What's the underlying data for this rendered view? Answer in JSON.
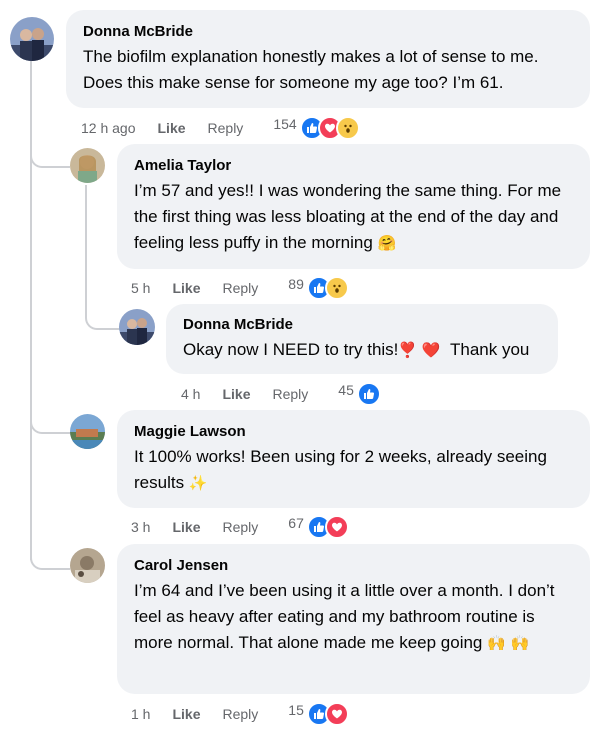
{
  "comments": [
    {
      "author": "Donna McBride",
      "text": "The biofilm explanation honestly makes a lot of sense to me. Does this make sense for someone my age too? I’m 61.",
      "time": "12 h ago",
      "like": "Like",
      "reply": "Reply",
      "count": "154",
      "reactions": [
        "like-icon",
        "love-icon",
        "wow-icon"
      ]
    },
    {
      "author": "Amelia Taylor",
      "text": "I’m 57 and yes!! I was wondering the same thing. For me the first thing was less bloating at the end of the day and feeling less puffy in the morning",
      "emoji": "🤗",
      "time": "5 h",
      "like": "Like",
      "reply": "Reply",
      "count": "89",
      "reactions": [
        "like-icon",
        "wow-icon"
      ]
    },
    {
      "author": "Donna McBride",
      "text": "Okay now I NEED to try this!",
      "emoji": "❣️ ❤️",
      "text_end": "Thank you",
      "time": "4 h",
      "like": "Like",
      "reply": "Reply",
      "count": "45",
      "reactions": [
        "like-icon"
      ]
    },
    {
      "author": "Maggie Lawson",
      "text": "It 100% works! Been using for 2 weeks, already seeing results",
      "emoji": "✨",
      "time": "3 h",
      "like": "Like",
      "reply": "Reply",
      "count": "67",
      "reactions": [
        "like-icon",
        "love-icon"
      ]
    },
    {
      "author": "Carol Jensen",
      "text": "I’m 64 and I’ve been using it a little over a month. I don’t feel as heavy after eating and my bathroom routine is more normal. That alone made me keep going",
      "emoji": "🙌 🙌",
      "time": "1 h",
      "like": "Like",
      "reply": "Reply",
      "count": "15",
      "reactions": [
        "like-icon",
        "love-icon"
      ]
    }
  ],
  "colors": {
    "like": "#1877f2",
    "love": "#f33e58",
    "wow": "#f7c94b",
    "bubble": "#f0f2f5",
    "meta": "#65676b"
  }
}
